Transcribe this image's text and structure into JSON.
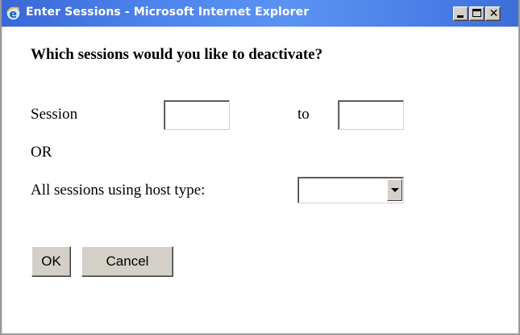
{
  "window": {
    "title": "Enter Sessions - Microsoft Internet Explorer",
    "controls": {
      "close_glyph": "✕"
    },
    "colors": {
      "titlebar_accent": "#4e84ec",
      "button_face": "#d4d0c8"
    }
  },
  "form": {
    "heading": "Which sessions would you like to deactivate?",
    "session_label": "Session",
    "session_from_value": "",
    "to_label": "to",
    "session_to_value": "",
    "or_label": "OR",
    "host_type_label": "All sessions using host type:",
    "host_type_selected": ""
  },
  "buttons": {
    "ok_label": "OK",
    "cancel_label": "Cancel"
  }
}
